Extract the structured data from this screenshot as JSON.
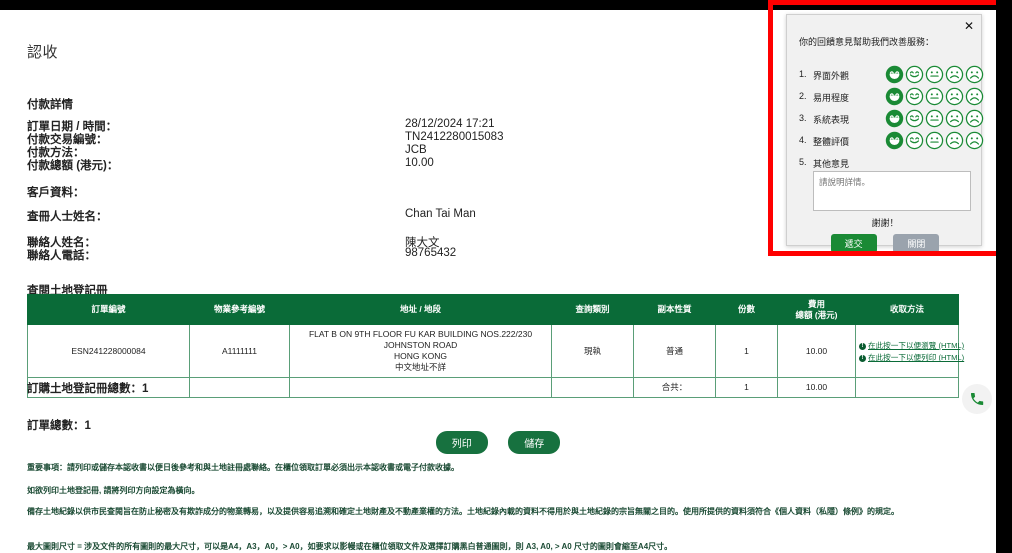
{
  "document": {
    "title": "認收",
    "payment_section_heading": "付款詳情",
    "customer_section_heading": "客戶資料：",
    "payment_details": [
      {
        "label": "訂單日期 / 時間：",
        "value": "28/12/2024 17:21"
      },
      {
        "label": "付款交易編號：",
        "value": "TN2412280015083"
      },
      {
        "label": "付款方法：",
        "value": "JCB"
      },
      {
        "label": "付款總額 (港元)：",
        "value": "10.00"
      }
    ],
    "customer_details": [
      {
        "label": "查冊人士姓名：",
        "value": "Chan Tai Man"
      },
      {
        "label": "聯絡人姓名：",
        "value": "陳大文"
      },
      {
        "label": "聯絡人電話：",
        "value": "98765432"
      }
    ],
    "register_heading": "查閱土地登記冊",
    "table": {
      "columns": [
        "訂單編號",
        "物業參考編號",
        "地址 / 地段",
        "查詢類別",
        "副本性質",
        "份數",
        "費用\n總額 (港元)",
        "收取方法"
      ],
      "fee_header_line1": "費用",
      "fee_header_line2": "總額 (港元)",
      "rows": [
        {
          "order_no": "ESN241228000084",
          "property_ref": "A1111111",
          "address_line1": "FLAT B ON 9TH FLOOR FU KAR BUILDING NOS.222/230 JOHNSTON ROAD",
          "address_line2": "HONG KONG",
          "address_line3": "中文地址不詳",
          "search_type": "現執",
          "copy_nature": "普通",
          "copies": "1",
          "fee_total": "10.00",
          "collect_links": [
            "在此按一下以便瀏覽 (HTML)",
            "在此按一下以便列印 (HTML)"
          ],
          "info_icon_glyph": "!"
        }
      ],
      "total_row": {
        "label": "合共：",
        "copies": "1",
        "fee_total": "10.00"
      }
    },
    "total_registers": "訂購土地登記冊總數：1",
    "total_orders": "訂單總數：1",
    "buttons": {
      "print": "列印",
      "save": "儲存"
    },
    "notes": [
      "重要事項：請列印或儲存本認收書以便日後參考和與土地註冊處聯絡。在櫃位領取訂單必須出示本認收書或電子付款收據。",
      "如欲列印土地登記冊, 請將列印方向設定為橫向。",
      "備存土地紀錄以供市民查閱旨在防止秘密及有欺詐成分的物業轉易，以及提供容易追溯和確定土地財產及不動產業權的方法。土地紀錄內載的資料不得用於與土地紀錄的宗旨無關之目的。使用所提供的資料須符合《個人資料（私隱）條例》的規定。",
      "最大圖則尺寸 = 涉及文件的所有圖則的最大尺寸，可以是A4，A3，A0，> A0，如要求以影幔或在櫃位領取文件及選擇訂購黑白普通圖則，則 A3, A0, > A0 尺寸的圖則會縮至A4尺寸。"
    ],
    "phone_fab": {
      "icon": "phone-icon",
      "color": "#1a8a35"
    }
  },
  "feedback_popup": {
    "title": "你的回饋意見幫助我們改善服務：",
    "close_glyph": "✕",
    "rows": [
      {
        "num": "1.",
        "label": "界面外觀",
        "selected_index": 0
      },
      {
        "num": "2.",
        "label": "易用程度",
        "selected_index": 0
      },
      {
        "num": "3.",
        "label": "系統表現",
        "selected_index": 0
      },
      {
        "num": "4.",
        "label": "整體評價",
        "selected_index": 0
      },
      {
        "num": "5.",
        "label": "其他意見",
        "selected_index": -1
      }
    ],
    "face_count": 5,
    "textarea_placeholder": "請說明詳情。",
    "textarea_value": "",
    "thanks": "謝謝！",
    "submit_label": "遞交",
    "cancel_label": "關閉",
    "accent_color": "#1a8a35"
  },
  "annotation": {
    "highlight_color": "#ff0000"
  }
}
